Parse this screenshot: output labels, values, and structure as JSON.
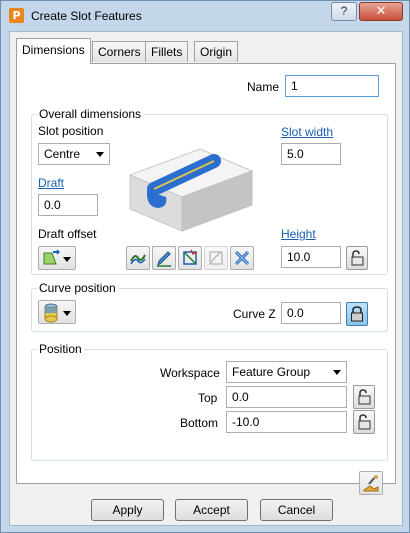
{
  "window": {
    "title": "Create Slot Features",
    "help_label": "?",
    "close_label": "✕"
  },
  "tabs": [
    {
      "label": "Dimensions",
      "active": true
    },
    {
      "label": "Corners",
      "active": false
    },
    {
      "label": "Fillets",
      "active": false
    },
    {
      "label": "Origin",
      "active": false
    }
  ],
  "name": {
    "label": "Name",
    "value": "1"
  },
  "overall": {
    "title": "Overall dimensions",
    "slot_position_label": "Slot position",
    "slot_position_value": "Centre",
    "slot_width_label": "Slot width",
    "slot_width_value": "5.0",
    "draft_label": "Draft",
    "draft_value": "0.0",
    "draft_offset_label": "Draft offset",
    "height_label": "Height",
    "height_value": "10.0",
    "height_locked": false
  },
  "curve": {
    "title": "Curve position",
    "curve_z_label": "Curve Z",
    "curve_z_value": "0.0",
    "curve_z_locked": true
  },
  "position": {
    "title": "Position",
    "workspace_label": "Workspace",
    "workspace_value": "Feature Group",
    "top_label": "Top",
    "top_value": "0.0",
    "bottom_label": "Bottom",
    "bottom_value": "-10.0"
  },
  "buttons": {
    "apply": "Apply",
    "accept": "Accept",
    "cancel": "Cancel"
  },
  "icons": [
    "slot-preview-image",
    "draft-offset-icon",
    "curve-icon",
    "reverse-curve-icon",
    "edit-curve-icon",
    "select-curve-icon",
    "deselect-curve-icon",
    "delete-curve-icon",
    "lock-icon",
    "apply-position-icon"
  ],
  "colors": {
    "accent_link": "#1a5fb4",
    "window_frame": "#c4d6ea",
    "close": "#c9503a"
  }
}
